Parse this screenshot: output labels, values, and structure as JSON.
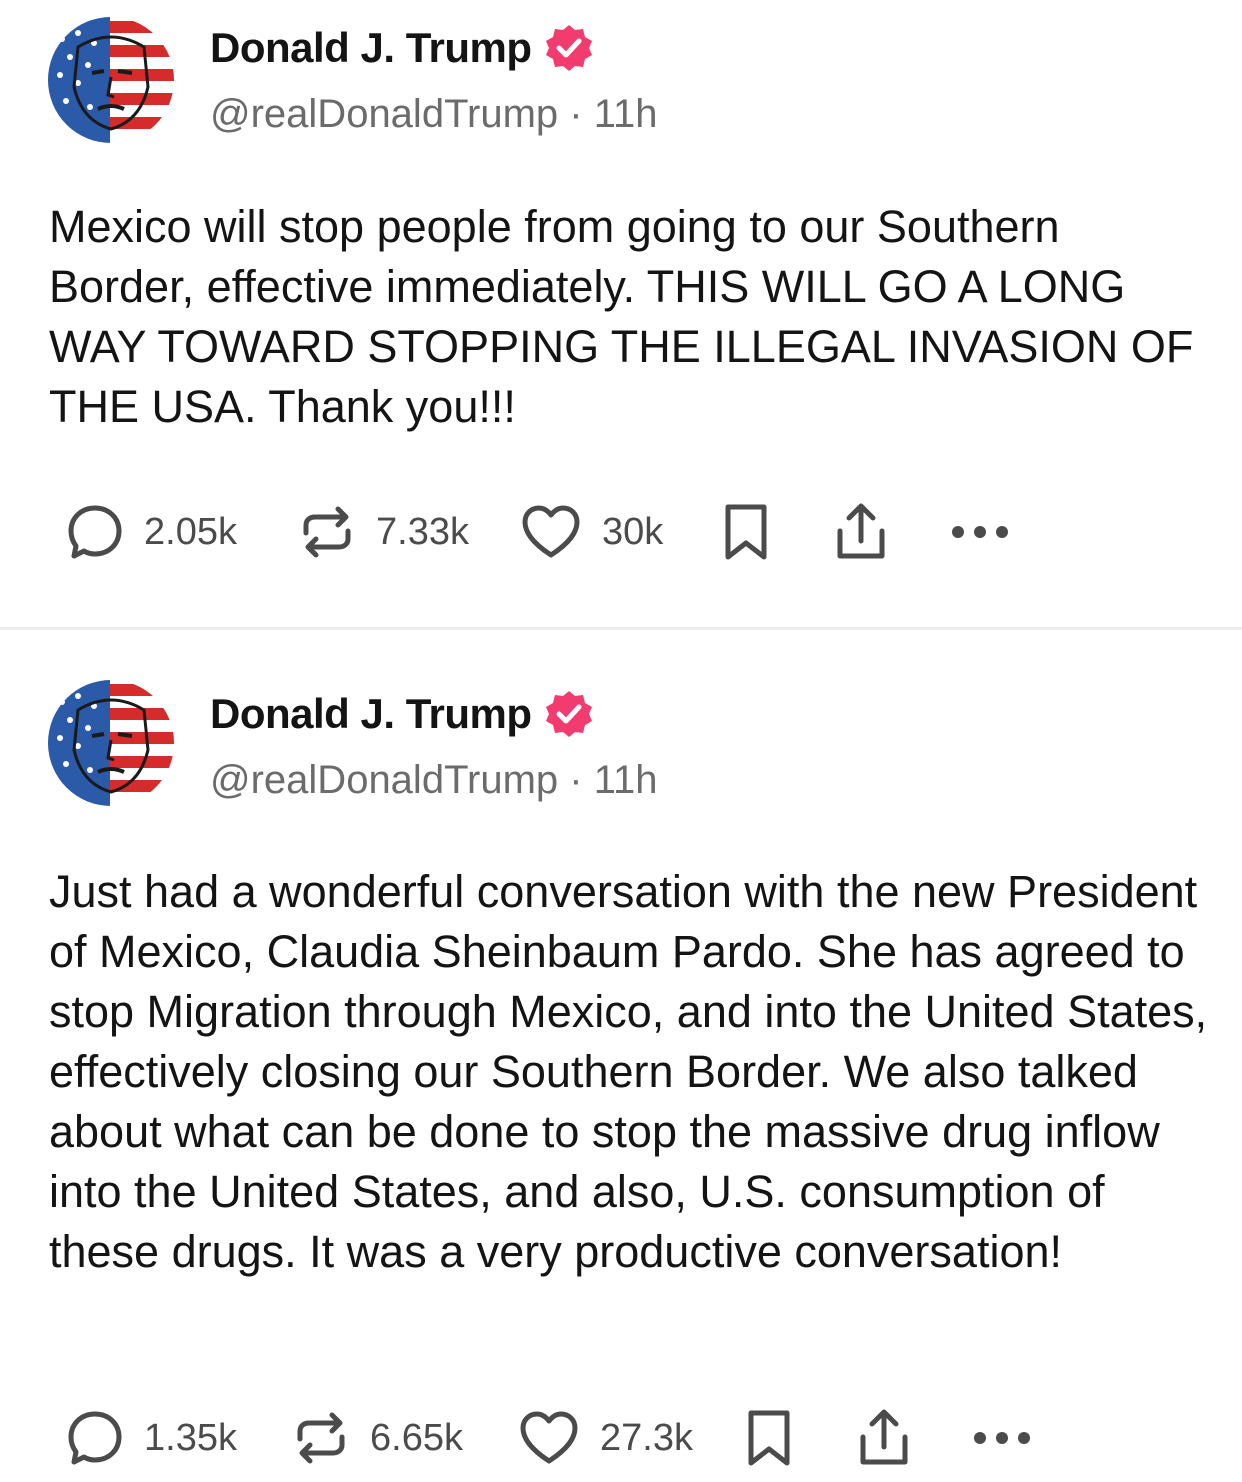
{
  "posts": [
    {
      "author": "Donald J. Trump",
      "handle": "@realDonaldTrump",
      "separator": "·",
      "time": "11h",
      "text": "Mexico will stop people from going to our Southern Border, effective immediately. THIS WILL GO A LONG WAY TOWARD STOPPING THE ILLEGAL INVASION OF THE USA. Thank you!!!",
      "replies": "2.05k",
      "reposts": "7.33k",
      "likes": "30k"
    },
    {
      "author": "Donald J. Trump",
      "handle": "@realDonaldTrump",
      "separator": "·",
      "time": "11h",
      "text": "Just had a wonderful conversation with the new President of Mexico, Claudia Sheinbaum Pardo. She has agreed to stop Migration through Mexico, and into the United States, effectively closing our Southern Border. We also talked about what can be done to stop the massive drug inflow into the United States, and also, U.S. consumption of these drugs. It was a very productive conversation!",
      "replies": "1.35k",
      "reposts": "6.65k",
      "likes": "27.3k"
    }
  ],
  "icons": {
    "verified": "verified-badge-icon",
    "reply": "comment-bubble-icon",
    "repost": "repost-icon",
    "like": "heart-icon",
    "bookmark": "bookmark-icon",
    "share": "share-icon",
    "more": "more-dots-icon"
  },
  "colors": {
    "verified_badge": "#f23b6e",
    "text": "#141414",
    "secondary_text": "#6b6b6b",
    "divider": "#ececec"
  }
}
